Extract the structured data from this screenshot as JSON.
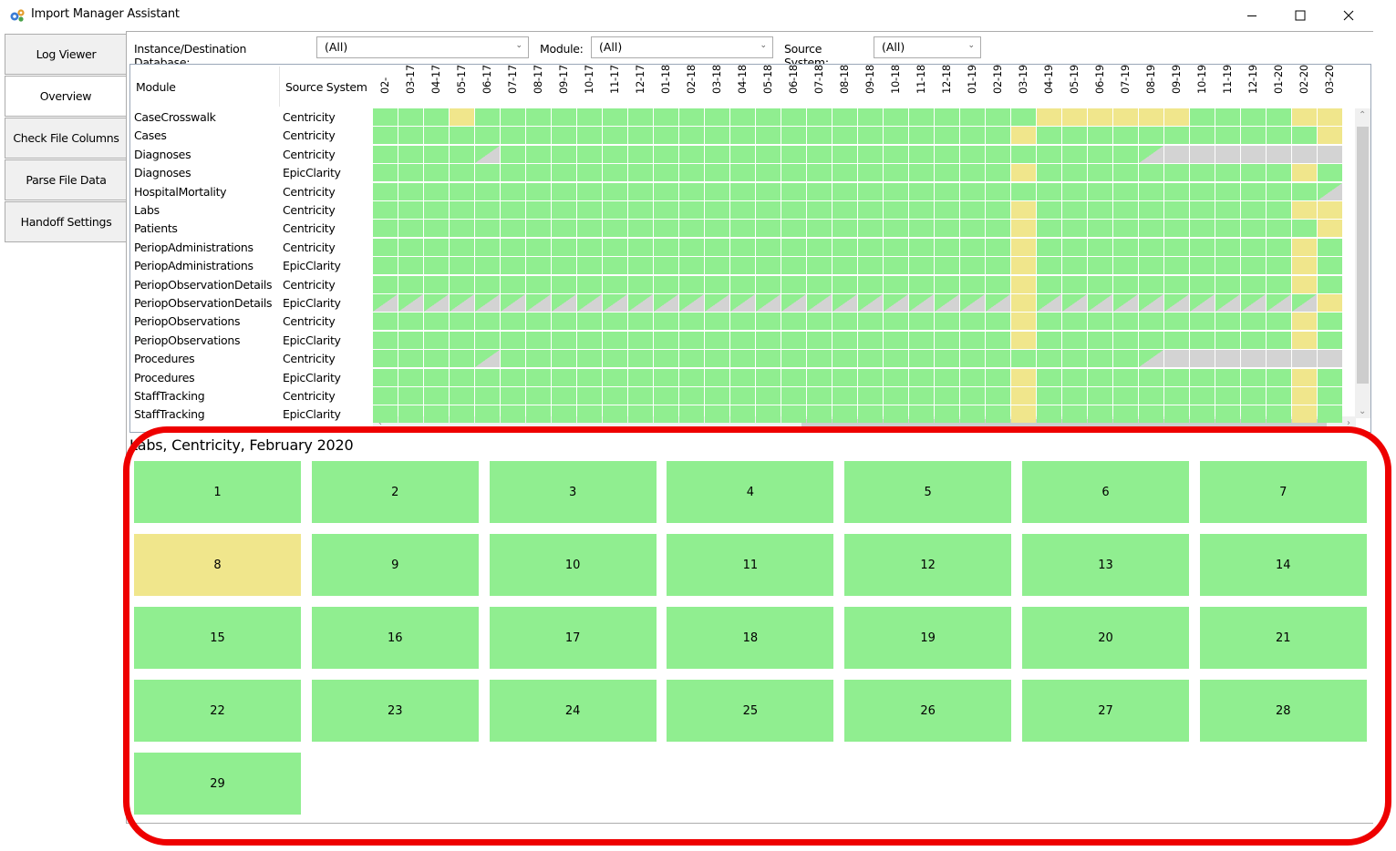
{
  "window": {
    "title": "Import Manager Assistant",
    "minimize_glyph": "—",
    "maximize_glyph": "☐",
    "close_glyph": "✕"
  },
  "sidebar": {
    "tabs": [
      {
        "label": "Log Viewer",
        "active": false
      },
      {
        "label": "Overview",
        "active": true
      },
      {
        "label": "Check File Columns",
        "active": false
      },
      {
        "label": "Parse File Data",
        "active": false
      },
      {
        "label": "Handoff Settings",
        "active": false
      }
    ]
  },
  "filters": {
    "instance_label": "Instance/Destination Database:",
    "instance_value": "(All)",
    "module_label": "Module:",
    "module_value": "(All)",
    "source_label": "Source System:",
    "source_value": "(All)"
  },
  "grid": {
    "header_module": "Module",
    "header_source": "Source System",
    "months": [
      "02-",
      "03-17",
      "04-17",
      "05-17",
      "06-17",
      "07-17",
      "08-17",
      "09-17",
      "10-17",
      "11-17",
      "12-17",
      "01-18",
      "02-18",
      "03-18",
      "04-18",
      "05-18",
      "06-18",
      "07-18",
      "08-18",
      "09-18",
      "10-18",
      "11-18",
      "12-18",
      "01-19",
      "02-19",
      "03-19",
      "04-19",
      "05-19",
      "06-19",
      "07-19",
      "08-19",
      "09-19",
      "10-19",
      "11-19",
      "12-19",
      "01-20",
      "02-20",
      "03-20"
    ],
    "rows": [
      {
        "module": "CaseCrosswalk",
        "source": "Centricity",
        "cells": "gggyggggggggggggggggggggggyyyyyyggggyyyy"
      },
      {
        "module": "Cases",
        "source": "Centricity",
        "cells": "gggggggggggggggggggggggggygggggggggggyyy"
      },
      {
        "module": "Diagnoses",
        "source": "Centricity",
        "cells": "ggggdgggggggggggggggggggggggggdxxxxxxxxx"
      },
      {
        "module": "Diagnoses",
        "source": "EpicClarity",
        "cells": "gggggggggggggggggggggggggyggggggggggygyy"
      },
      {
        "module": "HospitalMortality",
        "source": "Centricity",
        "cells": "gggggggggggggggggggggggggggggggggggggdgd"
      },
      {
        "module": "Labs",
        "source": "Centricity",
        "cells": "gggggggggggggggggggggggggyggggggggggyysy"
      },
      {
        "module": "Patients",
        "source": "Centricity",
        "cells": "gggggggggggggggggggggggggygggggggggggyyy"
      },
      {
        "module": "PeriopAdministrations",
        "source": "Centricity",
        "cells": "gggggggggggggggggggggggggyggggggggggygyy"
      },
      {
        "module": "PeriopAdministrations",
        "source": "EpicClarity",
        "cells": "gggggggggggggggggggggggggyggggggggggygyy"
      },
      {
        "module": "PeriopObservationDetails",
        "source": "Centricity",
        "cells": "gggggggggggggggggggggggggyggggggggggygyy"
      },
      {
        "module": "PeriopObservationDetails",
        "source": "EpicClarity",
        "cells": "dddddddddddddddddddddddddydddddddddddydy"
      },
      {
        "module": "PeriopObservations",
        "source": "Centricity",
        "cells": "gggggggggggggggggggggggggyggggggggggygyy"
      },
      {
        "module": "PeriopObservations",
        "source": "EpicClarity",
        "cells": "gggggggggggggggggggggggggyggggggggggygyy"
      },
      {
        "module": "Procedures",
        "source": "Centricity",
        "cells": "ggggdgggggggggggggggggggggggggdxxxxxxxxx"
      },
      {
        "module": "Procedures",
        "source": "EpicClarity",
        "cells": "gggggggggggggggggggggggggyggggggggggygyy"
      },
      {
        "module": "StaffTracking",
        "source": "Centricity",
        "cells": "gggggggggggggggggggggggggyggggggggggygyy"
      },
      {
        "module": "StaffTracking",
        "source": "EpicClarity",
        "cells": "gggggggggggggggggggggggggyggggggggggygyy"
      }
    ]
  },
  "calendar": {
    "caption": "Labs, Centricity, February 2020",
    "days": [
      {
        "n": "1",
        "s": "g"
      },
      {
        "n": "2",
        "s": "g"
      },
      {
        "n": "3",
        "s": "g"
      },
      {
        "n": "4",
        "s": "g"
      },
      {
        "n": "5",
        "s": "g"
      },
      {
        "n": "6",
        "s": "g"
      },
      {
        "n": "7",
        "s": "g"
      },
      {
        "n": "8",
        "s": "y"
      },
      {
        "n": "9",
        "s": "g"
      },
      {
        "n": "10",
        "s": "g"
      },
      {
        "n": "11",
        "s": "g"
      },
      {
        "n": "12",
        "s": "g"
      },
      {
        "n": "13",
        "s": "g"
      },
      {
        "n": "14",
        "s": "g"
      },
      {
        "n": "15",
        "s": "g"
      },
      {
        "n": "16",
        "s": "g"
      },
      {
        "n": "17",
        "s": "g"
      },
      {
        "n": "18",
        "s": "g"
      },
      {
        "n": "19",
        "s": "g"
      },
      {
        "n": "20",
        "s": "g"
      },
      {
        "n": "21",
        "s": "g"
      },
      {
        "n": "22",
        "s": "g"
      },
      {
        "n": "23",
        "s": "g"
      },
      {
        "n": "24",
        "s": "g"
      },
      {
        "n": "25",
        "s": "g"
      },
      {
        "n": "26",
        "s": "g"
      },
      {
        "n": "27",
        "s": "g"
      },
      {
        "n": "28",
        "s": "g"
      },
      {
        "n": "29",
        "s": "g"
      }
    ]
  },
  "colors": {
    "ok": "#90ee90",
    "warn": "#f0e68c",
    "missing": "#d3d3d3",
    "highlight": "#ee0000"
  },
  "icons": {
    "app": "app-gears-icon",
    "scroll_up": "▲",
    "scroll_down": "▼",
    "scroll_left": "◀",
    "scroll_right": "▶",
    "combo_arrow": "⌄"
  }
}
